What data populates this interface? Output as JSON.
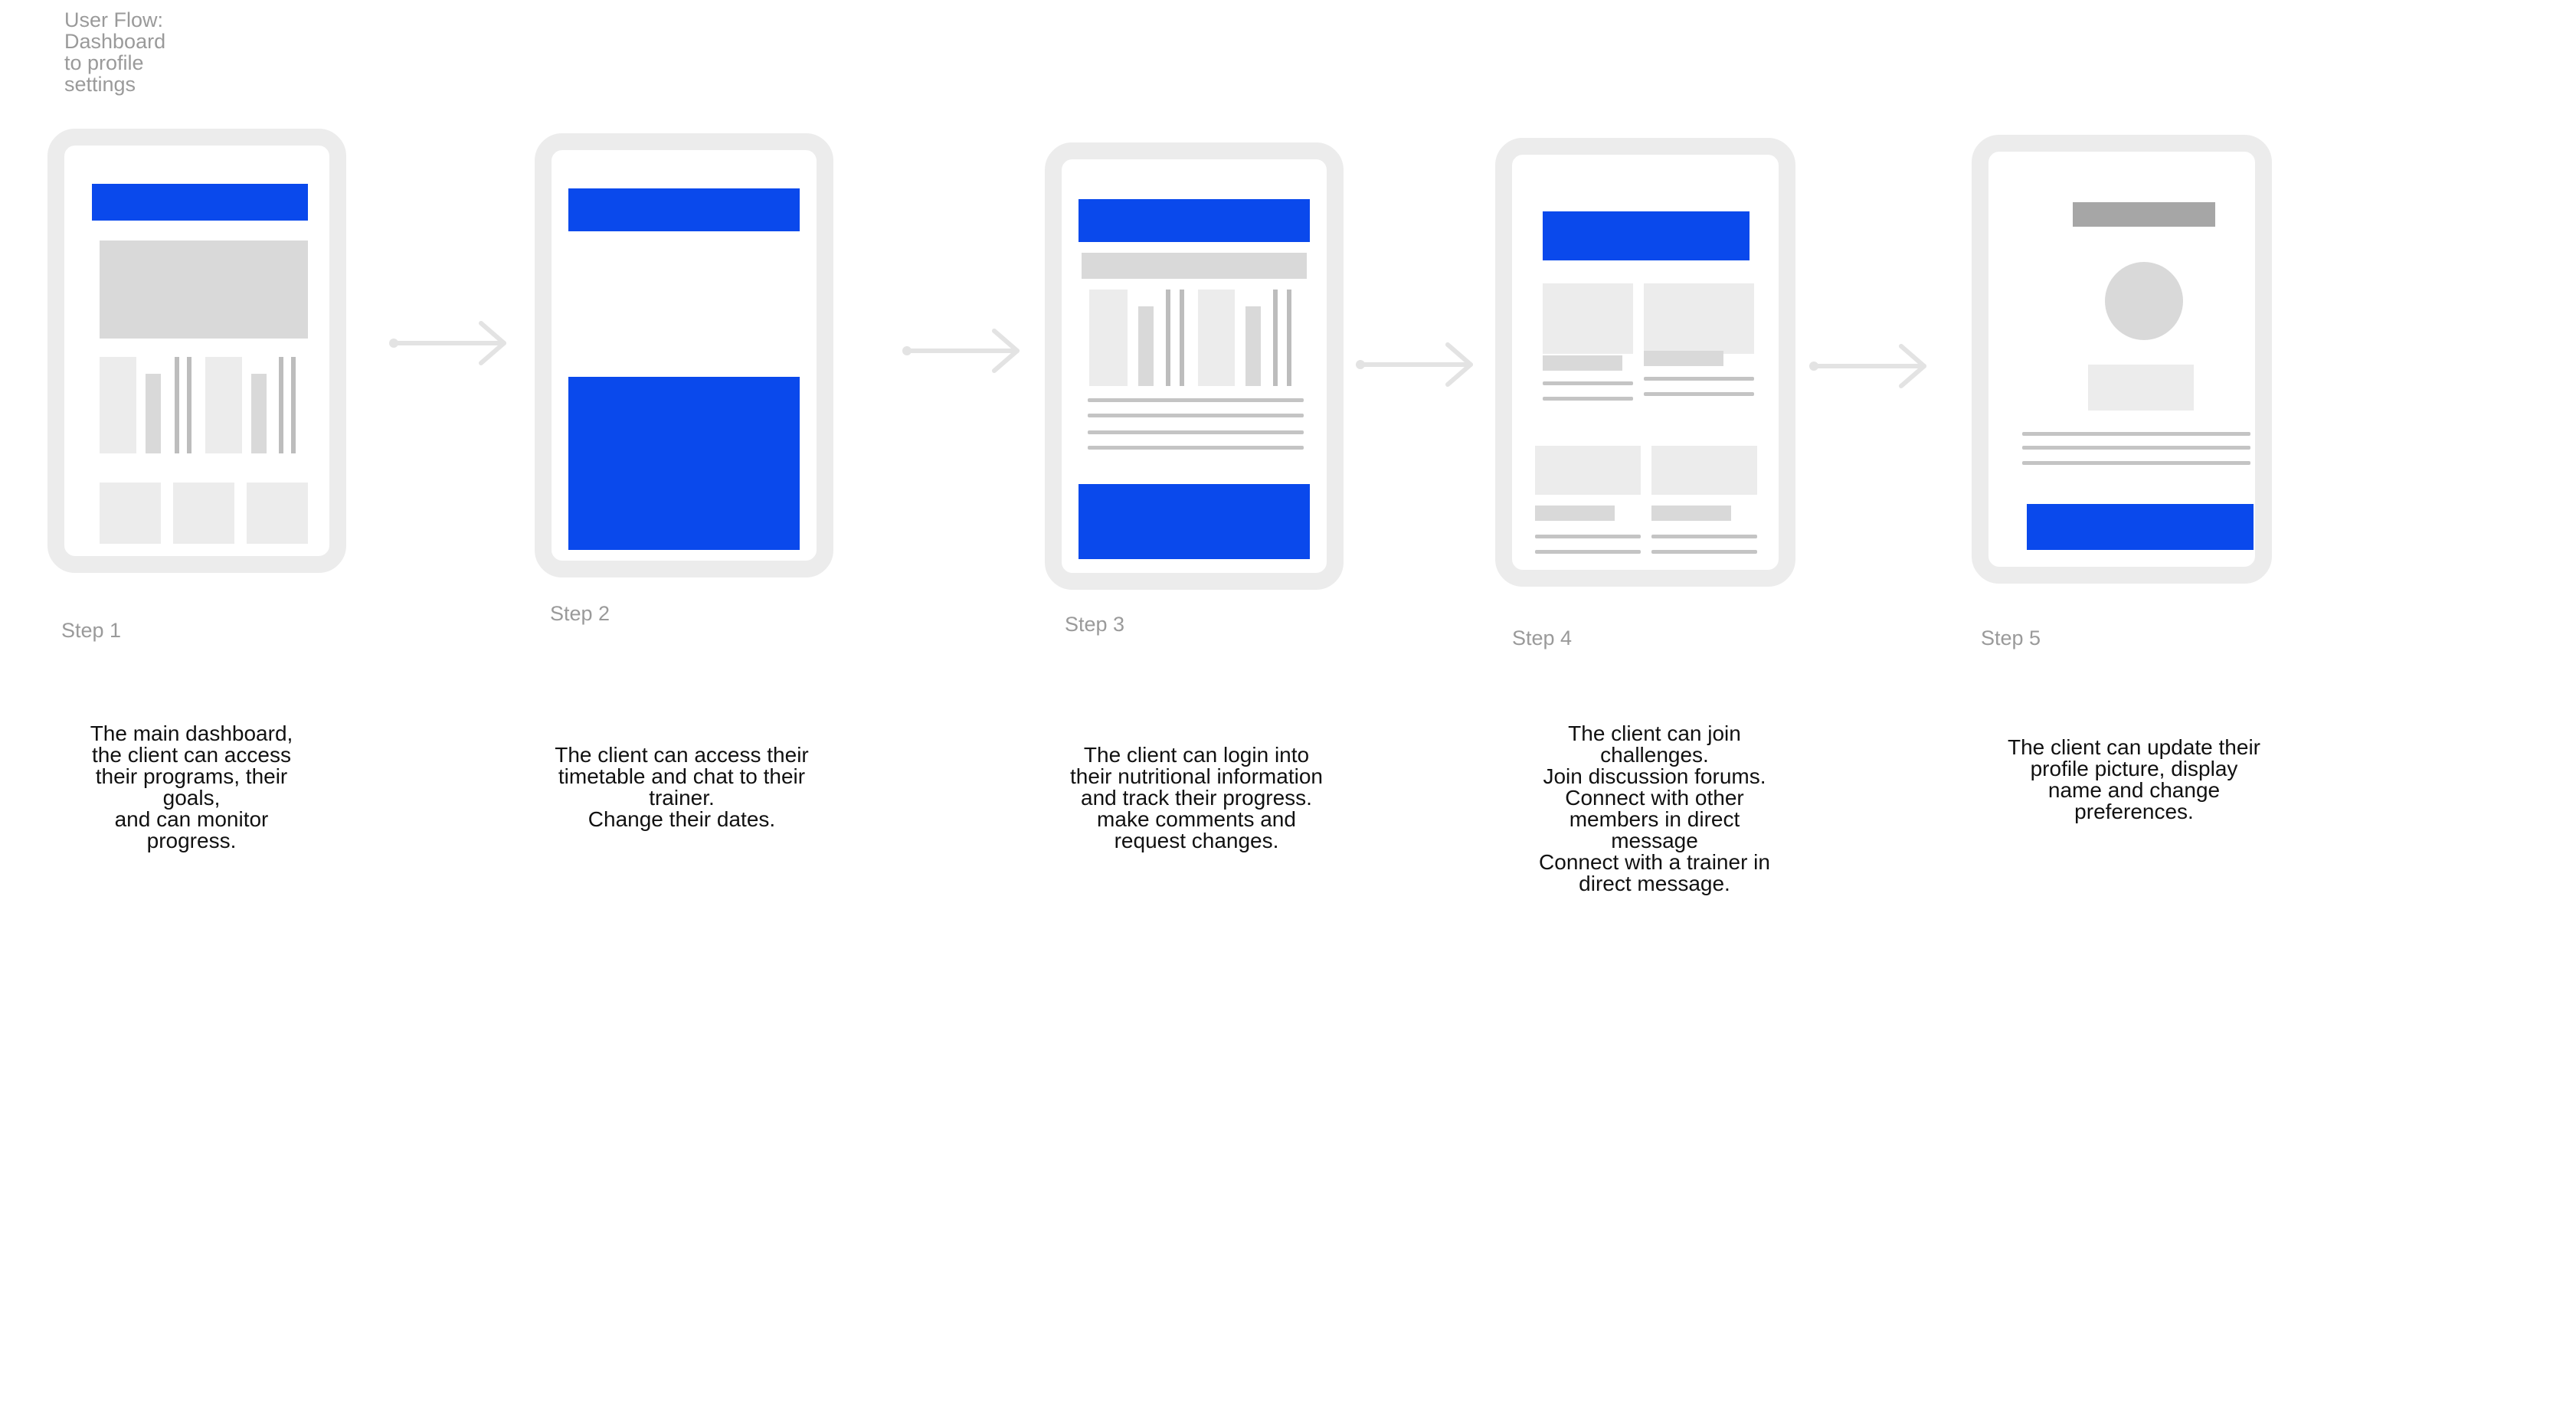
{
  "title": "User Flow:\nDashboard\nto profile\nsettings",
  "colors": {
    "accent_blue": "#0a49ec",
    "frame_gray": "#ececec",
    "placeholder_gray": "#d9d9d9",
    "line_gray": "#c4c4c4",
    "label_gray": "#9a9a9a"
  },
  "steps": [
    {
      "label": "Step 1",
      "description": "The main dashboard,\nthe client can access\ntheir programs, their\ngoals,\nand can monitor\nprogress."
    },
    {
      "label": "Step 2",
      "description": "The client can access their\ntimetable and chat to their\ntrainer.\nChange their dates."
    },
    {
      "label": "Step 3",
      "description": "The client can login into\ntheir nutritional information\nand track their progress.\nmake comments and\nrequest changes."
    },
    {
      "label": "Step 4",
      "description": "The client can join\nchallenges.\nJoin discussion forums.\nConnect with other\nmembers in direct\nmessage\nConnect with a trainer in\ndirect message."
    },
    {
      "label": "Step 5",
      "description": "The client can update their\nprofile picture, display\nname and change\npreferences."
    }
  ]
}
